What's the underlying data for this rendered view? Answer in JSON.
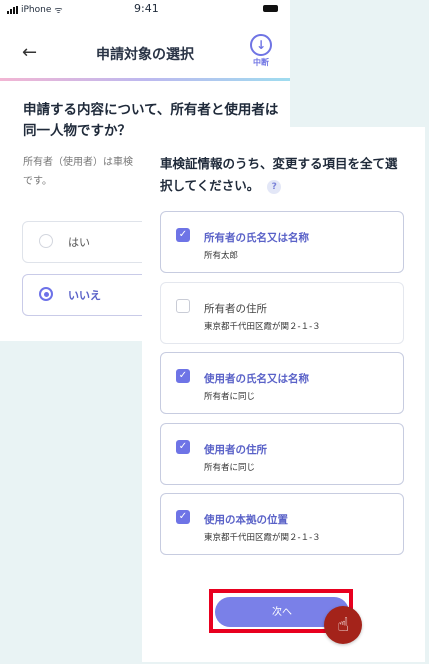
{
  "status_bar": {
    "carrier": "iPhone",
    "time": "9:41"
  },
  "back_screen": {
    "title": "申請対象の選択",
    "pause_label": "中断",
    "question_line1": "申請する内容について、所有者と使用者は",
    "question_line2": "同一人物ですか？",
    "desc_line1": "所有者（使用者）は車検",
    "desc_line2": "です。",
    "options": [
      {
        "label": "はい",
        "selected": false
      },
      {
        "label": "いいえ",
        "selected": true
      }
    ]
  },
  "front_screen": {
    "instruction_line1": "車検証情報のうち、変更する項目を全て選",
    "instruction_line2": "択してください。",
    "help_icon": "?",
    "items": [
      {
        "title": "所有者の氏名又は名称",
        "value": "所有太郎",
        "checked": true
      },
      {
        "title": "所有者の住所",
        "value": "東京都千代田区霞が関２-１-３",
        "checked": false
      },
      {
        "title": "使用者の氏名又は名称",
        "value": "所有者に同じ",
        "checked": true
      },
      {
        "title": "使用者の住所",
        "value": "所有者に同じ",
        "checked": true
      },
      {
        "title": "使用の本拠の位置",
        "value": "東京都千代田区霞が関２-１-３",
        "checked": true
      }
    ],
    "next_button": "次へ"
  },
  "colors": {
    "accent": "#6e74e6",
    "highlight": "#e8001f",
    "cursor": "#a4231a",
    "background": "#e9f3f4"
  },
  "icons": {
    "back": "arrow-left-icon",
    "pause": "download-circle-icon",
    "cursor": "hand-pointer-icon",
    "check": "checkmark-icon"
  }
}
